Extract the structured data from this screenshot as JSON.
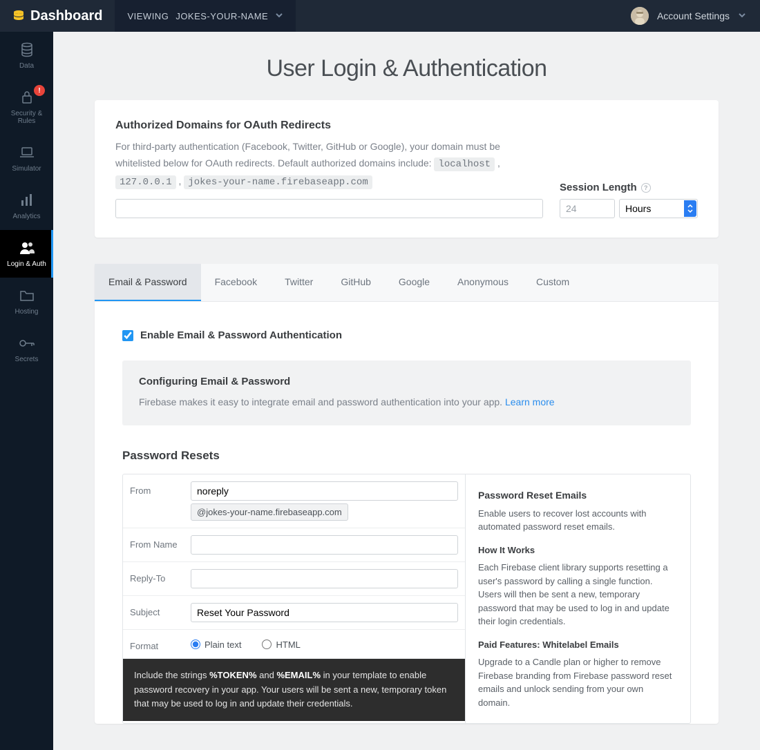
{
  "topbar": {
    "brand": "Dashboard",
    "viewing_prefix": "VIEWING ",
    "viewing_project": "JOKES-YOUR-NAME",
    "account": "Account Settings"
  },
  "sidebar": {
    "items": [
      {
        "label": "Data"
      },
      {
        "label": "Security & Rules"
      },
      {
        "label": "Simulator"
      },
      {
        "label": "Analytics"
      },
      {
        "label": "Login & Auth"
      },
      {
        "label": "Hosting"
      },
      {
        "label": "Secrets"
      }
    ]
  },
  "page": {
    "title": "User Login & Authentication"
  },
  "oauth": {
    "heading": "Authorized Domains for OAuth Redirects",
    "desc_pre": "For third-party authentication (Facebook, Twitter, GitHub or Google), your domain must be whitelisted below for OAuth redirects. Default authorized domains include: ",
    "code1": "localhost",
    "sep1": " , ",
    "code2": "127.0.0.1",
    "sep2": " , ",
    "code3": "jokes-your-name.firebaseapp.com",
    "session_label": "Session Length",
    "session_value": "24",
    "session_unit": "Hours"
  },
  "tabs": [
    {
      "label": "Email & Password"
    },
    {
      "label": "Facebook"
    },
    {
      "label": "Twitter"
    },
    {
      "label": "GitHub"
    },
    {
      "label": "Google"
    },
    {
      "label": "Anonymous"
    },
    {
      "label": "Custom"
    }
  ],
  "enable": {
    "label": "Enable Email & Password Authentication"
  },
  "info": {
    "heading": "Configuring Email & Password",
    "body": "Firebase makes it easy to integrate email and password authentication into your app. ",
    "link": "Learn more"
  },
  "reset": {
    "heading": "Password Resets",
    "from_label": "From",
    "from_value": "noreply",
    "from_domain": "@jokes-your-name.firebaseapp.com",
    "from_name_label": "From Name",
    "from_name_value": "",
    "reply_label": "Reply-To",
    "reply_value": "",
    "subject_label": "Subject",
    "subject_value": "Reset Your Password",
    "format_label": "Format",
    "format_plain": "Plain text",
    "format_html": "HTML",
    "note_pre": "Include the strings ",
    "note_t1": "%TOKEN%",
    "note_mid": " and ",
    "note_t2": "%EMAIL%",
    "note_post": " in your template to enable password recovery in your app. Your users will be sent a new, temporary token that may be used to log in and update their credentials.",
    "side_h1": "Password Reset Emails",
    "side_p1": "Enable users to recover lost accounts with automated password reset emails.",
    "side_h2": "How It Works",
    "side_p2": "Each Firebase client library supports resetting a user's password by calling a single function. Users will then be sent a new, temporary password that may be used to log in and update their login credentials.",
    "side_h3": "Paid Features: Whitelabel Emails",
    "side_p3": "Upgrade to a Candle plan or higher to remove Firebase branding from Firebase password reset emails and unlock sending from your own domain."
  },
  "alert_badge": "!"
}
